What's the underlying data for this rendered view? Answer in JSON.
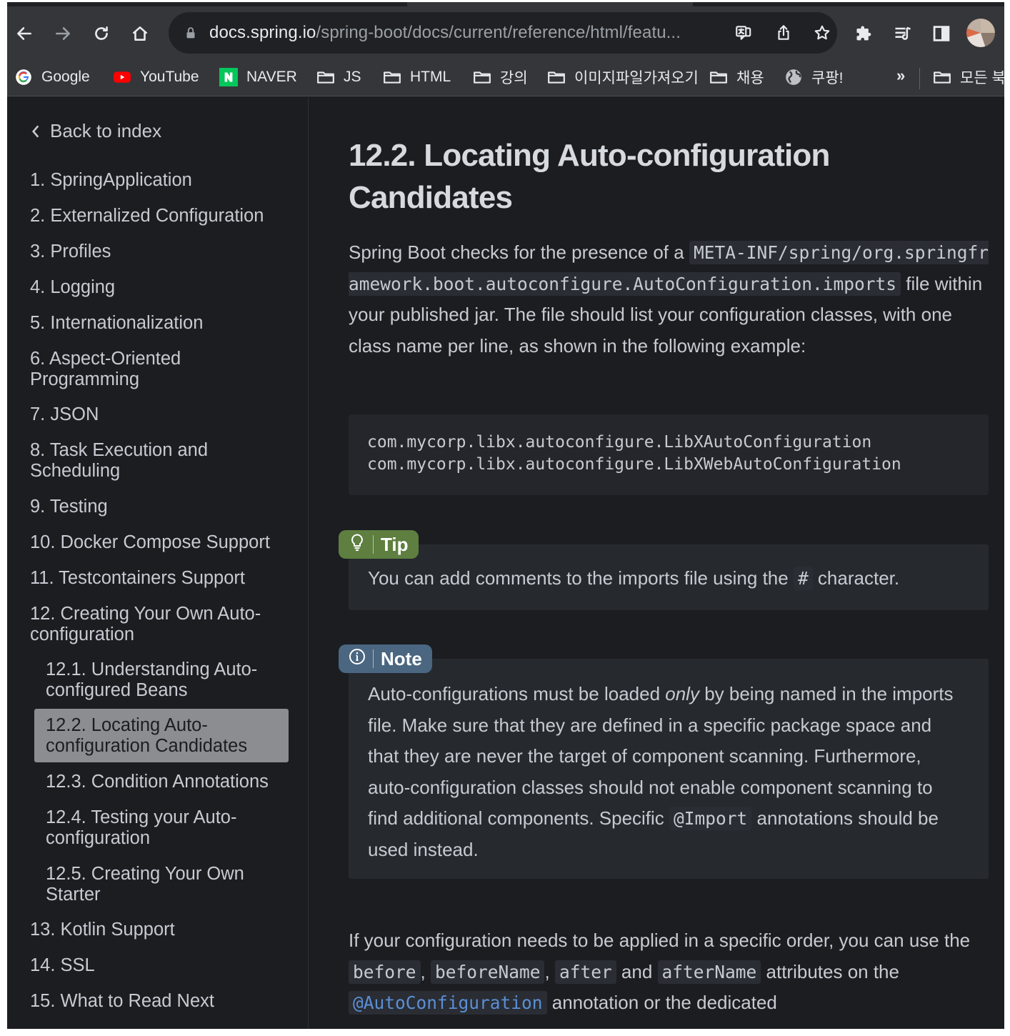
{
  "browser": {
    "url_host": "docs.spring.io",
    "url_path": "/spring-boot/docs/current/reference/html/featu...",
    "bookmarks": [
      {
        "label": "Google",
        "icon": "google-icon"
      },
      {
        "label": "YouTube",
        "icon": "youtube-icon"
      },
      {
        "label": "NAVER",
        "icon": "naver-icon"
      },
      {
        "label": "JS",
        "icon": "folder-icon"
      },
      {
        "label": "HTML",
        "icon": "folder-icon"
      },
      {
        "label": "강의",
        "icon": "folder-icon"
      },
      {
        "label": "이미지파일가져오기",
        "icon": "folder-icon"
      },
      {
        "label": "채용",
        "icon": "folder-icon"
      },
      {
        "label": "쿠팡!",
        "icon": "globe-icon"
      }
    ],
    "more_label": "»",
    "all_bookmarks_label": "모든 북"
  },
  "sidebar": {
    "back_label": "Back to index",
    "items": [
      {
        "label": "1. SpringApplication"
      },
      {
        "label": "2. Externalized Configuration"
      },
      {
        "label": "3. Profiles"
      },
      {
        "label": "4. Logging"
      },
      {
        "label": "5. Internationalization"
      },
      {
        "label": "6. Aspect-Oriented Programming"
      },
      {
        "label": "7. JSON"
      },
      {
        "label": "8. Task Execution and Scheduling"
      },
      {
        "label": "9. Testing"
      },
      {
        "label": "10. Docker Compose Support"
      },
      {
        "label": "11. Testcontainers Support"
      },
      {
        "label": "12. Creating Your Own Auto-configuration"
      },
      {
        "label": "12.1. Understanding Auto-configured Beans"
      },
      {
        "label": "12.2. Locating Auto-configuration Candidates"
      },
      {
        "label": "12.3. Condition Annotations"
      },
      {
        "label": "12.4. Testing your Auto-configuration"
      },
      {
        "label": "12.5. Creating Your Own Starter"
      },
      {
        "label": "13. Kotlin Support"
      },
      {
        "label": "14. SSL"
      },
      {
        "label": "15. What to Read Next"
      }
    ]
  },
  "content": {
    "title": "12.2. Locating Auto-configuration Candidates",
    "intro_1": "Spring Boot checks for the presence of a ",
    "intro_code": "META-INF/spring/org.springframework.boot.autoconfigure.AutoConfiguration.imports",
    "intro_2": " file within your published jar. The file should list your configuration classes, with one class name per line, as shown in the following example:",
    "code_lines": [
      "com.mycorp.libx.autoconfigure.LibXAutoConfiguration",
      "com.mycorp.libx.autoconfigure.LibXWebAutoConfiguration"
    ],
    "tip": {
      "label": "Tip",
      "text_1": "You can add comments to the imports file using the ",
      "code": "#",
      "text_2": " character."
    },
    "note": {
      "label": "Note",
      "text_1": "Auto-configurations must be loaded ",
      "emphasis": "only",
      "text_2": " by being named in the imports file. Make sure that they are defined in a specific package space and that they are never the target of component scanning. Furthermore, auto-configuration classes should not enable component scanning to find additional components. Specific ",
      "code": "@Import",
      "text_3": " annotations should be used instead."
    },
    "order": {
      "text_1": "If your configuration needs to be applied in a specific order, you can use the ",
      "code_before": "before",
      "sep_1": ", ",
      "code_beforeName": "beforeName",
      "sep_2": ", ",
      "code_after": "after",
      "text_and": " and ",
      "code_afterName": "afterName",
      "text_2": " attributes on the ",
      "code_autoconfig": "@AutoConfiguration",
      "text_3": " annotation or the dedicated"
    }
  },
  "colors": {
    "page_bg": "#1b1d21",
    "browser_bar": "#35363a",
    "tip_label": "#5e7f3f",
    "note_label": "#4a6680",
    "active_toc": "#8b8d91",
    "link_code": "#5b8fd6"
  }
}
